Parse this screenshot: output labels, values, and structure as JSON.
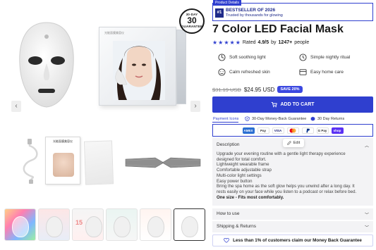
{
  "gallery": {
    "box_title": "光能面膜美容仪",
    "manual_title": "光能面膜美容仪",
    "badge": {
      "top": "30-DAY",
      "number": "30",
      "bottom": "GUARANTEE"
    },
    "prev_icon": "chevron-left-icon",
    "next_icon": "chevron-right-icon",
    "thumbnails": [
      {
        "caption": "",
        "number": ""
      },
      {
        "caption": "",
        "number": ""
      },
      {
        "caption": "",
        "number": "15"
      },
      {
        "caption": "",
        "number": ""
      },
      {
        "caption": "",
        "number": ""
      },
      {
        "caption": "",
        "number": ""
      }
    ]
  },
  "product_details": {
    "label": "Product Details",
    "rank": "#1",
    "bestseller": "BESTSELLER OF 2026",
    "trusted": "Trusted by thousands for glowing"
  },
  "title": "7 Color LED Facial Mask",
  "rating": {
    "stars": 5,
    "text_prefix": "Rated",
    "score": "4.9/5",
    "text_by": "by",
    "count": "1247+",
    "text_suffix": "people",
    "star_color": "#2f3fcf"
  },
  "features": [
    {
      "icon": "light-icon",
      "label": "Soft soothing light"
    },
    {
      "icon": "clock-icon",
      "label": "Simple nightly ritual"
    },
    {
      "icon": "smile-icon",
      "label": "Calm refreshed skin"
    },
    {
      "icon": "home-icon",
      "label": "Easy home care"
    }
  ],
  "price": {
    "old": "$31.19 USD",
    "new": "$24.95 USD",
    "save": "SAVE 20%"
  },
  "cart": {
    "label": "ADD TO CART",
    "icon": "cart-icon"
  },
  "payment": {
    "tab": "Payment Icons",
    "guarantee": "30-Day Money-Back Guarantee",
    "returns": "30 Day Returns",
    "methods": [
      "AMEX",
      "Pay",
      "VISA",
      "MC",
      "PayPal",
      "G Pay",
      "shop"
    ]
  },
  "edit_popup": {
    "label": "Edit",
    "icon": "pencil-icon"
  },
  "description": {
    "heading": "Description",
    "lines": [
      "Upgrade your evening routine with a gentle light therapy experience",
      "designed for total comfort.",
      "Lightweight wearable frame",
      "Comfortable adjustable strap",
      "Multi-color light settings",
      "Easy power button",
      "Bring the spa home as the soft glow helps you unwind after a long day. It",
      "rests easily on your face while you listen to a podcast or relax before bed."
    ],
    "size_note": "One size - Fits most comfortably."
  },
  "accordions": [
    {
      "label": "How to use"
    },
    {
      "label": "Shipping & Returns"
    }
  ],
  "money_back": {
    "label": "Less than 1% of customers claim our Money Back Guarantee",
    "icon": "heart-icon"
  },
  "colors": {
    "accent": "#2f3fcf",
    "panel": "#f3f3f5"
  }
}
